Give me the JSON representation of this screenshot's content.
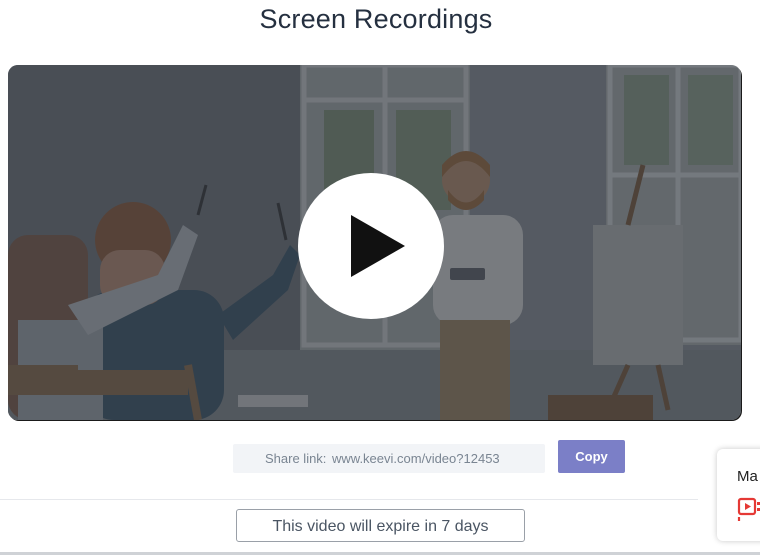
{
  "header": {
    "title": "Screen Recordings"
  },
  "player": {
    "thumbnail_icon": "classroom-presentation-image",
    "play_icon": "play-icon"
  },
  "share": {
    "label": "Share link:",
    "url": "www.keevi.com/video?12453",
    "copy_label": "Copy"
  },
  "expiry": {
    "text": "This video will expire in 7 days"
  },
  "side_widget": {
    "label": "Ma",
    "icon": "video-record-icon"
  },
  "colors": {
    "title": "#253040",
    "copy_button": "#7b7fc7",
    "share_box_bg": "#f2f4f7",
    "record_icon": "#e53935"
  }
}
